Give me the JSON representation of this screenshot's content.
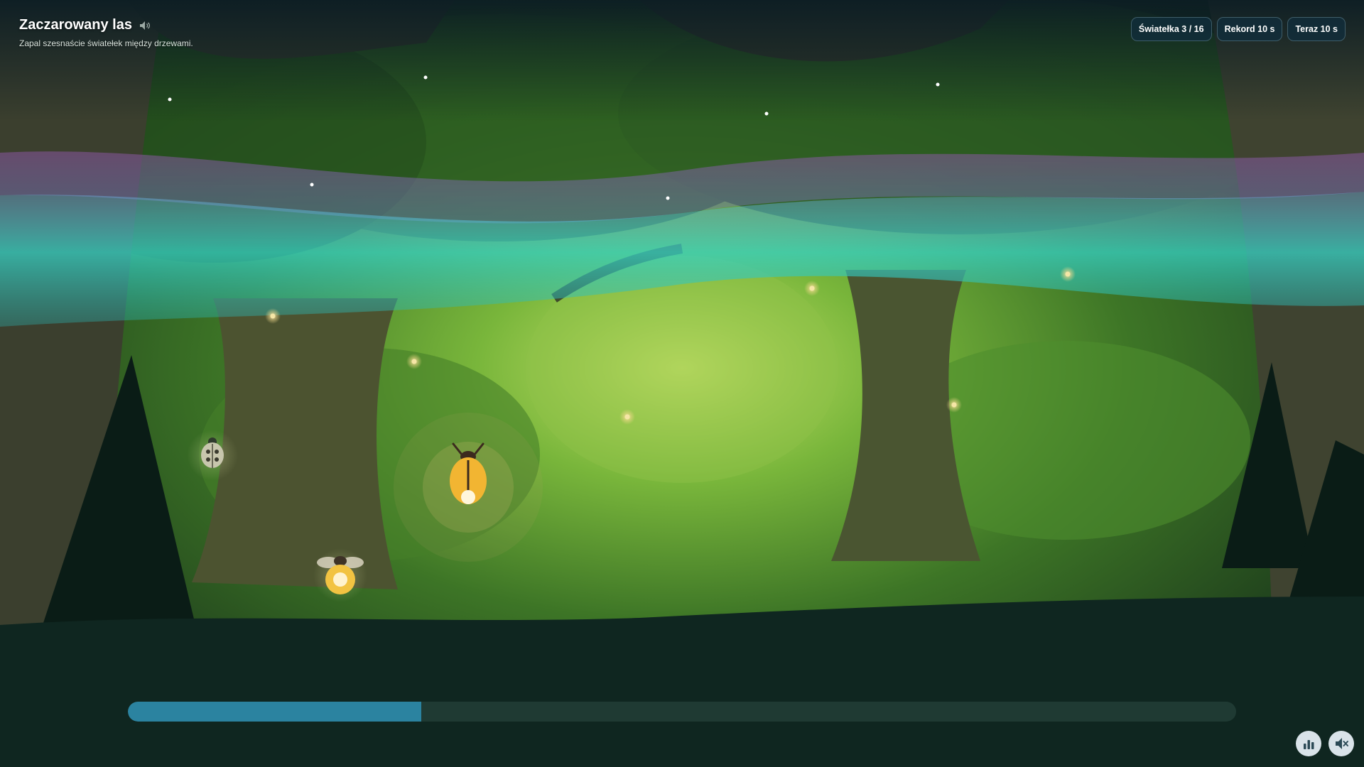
{
  "game": {
    "title": "Zaczarowany las",
    "subtitle": "Zapal szesnaście światełek między drzewami."
  },
  "stats": {
    "lights": "Światełka 3 / 16",
    "record": "Rekord 10 s",
    "current": "Teraz 10 s"
  },
  "progress": {
    "lit": 3,
    "total": 16,
    "fraction": 0.265
  },
  "icons": {
    "title_sound": "speaker-icon",
    "stats_button": "bar-chart-icon",
    "mute_button": "speaker-muted-icon"
  },
  "colors": {
    "progress_fill": "#2b83a0",
    "progress_track": "#1f3a33",
    "badge_bg": "#112d3a",
    "ground": "#0f2620",
    "aurora_teal": "#37c9c0",
    "aurora_purple": "#7a4a86",
    "firefly_glow": "#f3d98c"
  }
}
